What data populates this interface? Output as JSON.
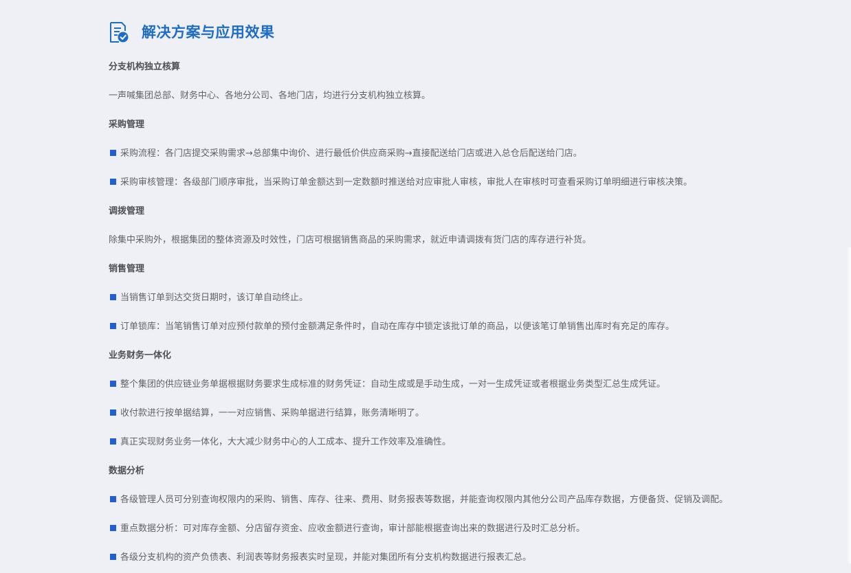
{
  "title": "解决方案与应用效果",
  "icon": "document-check-icon",
  "accent_color": "#1e6cc4",
  "bullet_color": "#1f5fcf",
  "sections": [
    {
      "heading": "分支机构独立核算",
      "items": [
        {
          "bullet": false,
          "text": "一声喊集团总部、财务中心、各地分公司、各地门店，均进行分支机构独立核算。"
        }
      ]
    },
    {
      "heading": "采购管理",
      "items": [
        {
          "bullet": true,
          "text": "采购流程：各门店提交采购需求→总部集中询价、进行最低价供应商采购→直接配送给门店或进入总仓后配送给门店。"
        },
        {
          "bullet": true,
          "text": "采购审核管理：各级部门顺序审批，当采购订单金额达到一定数额时推送给对应审批人审核，审批人在审核时可查看采购订单明细进行审核决策。"
        }
      ]
    },
    {
      "heading": "调拨管理",
      "items": [
        {
          "bullet": false,
          "text": "除集中采购外，根据集团的整体资源及时效性，门店可根据销售商品的采购需求，就近申请调拨有货门店的库存进行补货。"
        }
      ]
    },
    {
      "heading": "销售管理",
      "items": [
        {
          "bullet": true,
          "text": "当销售订单到达交货日期时，该订单自动终止。"
        },
        {
          "bullet": true,
          "text": "订单锁库：当笔销售订单对应预付款单的预付金额满足条件时，自动在库存中锁定该批订单的商品，以便该笔订单销售出库时有充足的库存。"
        }
      ]
    },
    {
      "heading": "业务财务一体化",
      "items": [
        {
          "bullet": true,
          "text": "整个集团的供应链业务单据根据财务要求生成标准的财务凭证：自动生成或是手动生成，一对一生成凭证或者根据业务类型汇总生成凭证。"
        },
        {
          "bullet": true,
          "text": "收付款进行按单据结算，一一对应销售、采购单据进行结算，账务清晰明了。"
        },
        {
          "bullet": true,
          "text": "真正实现财务业务一体化，大大减少财务中心的人工成本、提升工作效率及准确性。"
        }
      ]
    },
    {
      "heading": "数据分析",
      "items": [
        {
          "bullet": true,
          "text": "各级管理人员可分别查询权限内的采购、销售、库存、往来、费用、财务报表等数据，并能查询权限内其他分公司产品库存数据，方便备货、促销及调配。"
        },
        {
          "bullet": true,
          "text": "重点数据分析：可对库存金额、分店留存资金、应收金额进行查询，审计部能根据查询出来的数据进行及时汇总分析。"
        },
        {
          "bullet": true,
          "text": "各级分支机构的资产负债表、利润表等财务报表实时呈现，并能对集团所有分支机构数据进行报表汇总。"
        }
      ]
    }
  ]
}
